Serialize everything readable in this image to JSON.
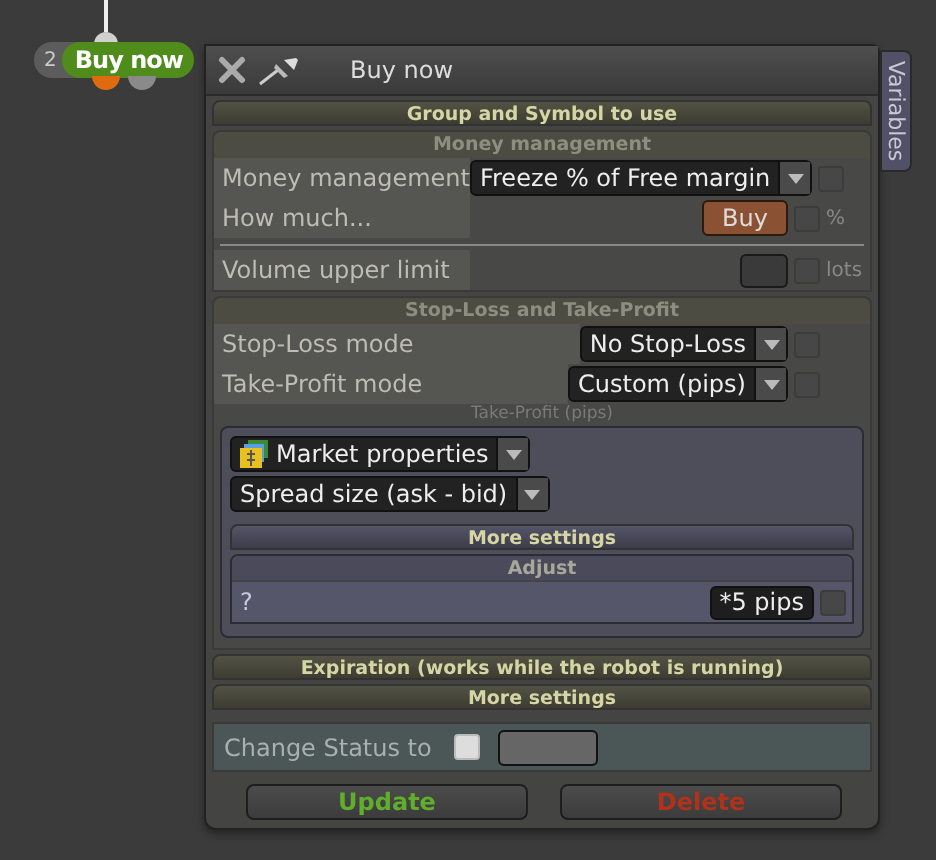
{
  "node": {
    "number": "2",
    "title": "Buy now"
  },
  "panel": {
    "title": "Buy now",
    "side_tab": "Variables"
  },
  "groups": [
    {
      "kind": "header",
      "label": "Group and Symbol to use"
    },
    {
      "kind": "section",
      "label": "Money management",
      "rows": [
        {
          "kind": "dropdown",
          "label": "Money management",
          "value": "Freeze % of Free margin",
          "checked": false
        },
        {
          "kind": "button",
          "label": "How much...",
          "value": "Buy",
          "unit": "%",
          "checked": false
        },
        {
          "kind": "divider"
        },
        {
          "kind": "input",
          "label": "Volume upper limit",
          "unit": "lots",
          "checked": false
        }
      ]
    },
    {
      "kind": "section",
      "label": "Stop-Loss and Take-Profit",
      "rows": [
        {
          "kind": "dropdown",
          "label": "Stop-Loss mode",
          "value": "No Stop-Loss",
          "checked": false
        },
        {
          "kind": "dropdown",
          "label": "Take-Profit mode",
          "value": "Custom (pips)",
          "checked": false
        }
      ],
      "sub": {
        "caption": "Take-Profit (pips)",
        "source": "Market properties",
        "property": "Spread size (ask - bid)",
        "more": "More settings",
        "adjust": {
          "title": "Adjust",
          "label": "?",
          "value": "*5 pips",
          "checked": false
        }
      }
    },
    {
      "kind": "header",
      "label": "Expiration (works while the robot is running)"
    },
    {
      "kind": "header",
      "label": "More settings"
    }
  ],
  "status": {
    "label": "Change Status to",
    "checked": false
  },
  "buttons": [
    {
      "label": "Update",
      "kind": "update"
    },
    {
      "label": "Delete",
      "kind": "delete"
    }
  ]
}
